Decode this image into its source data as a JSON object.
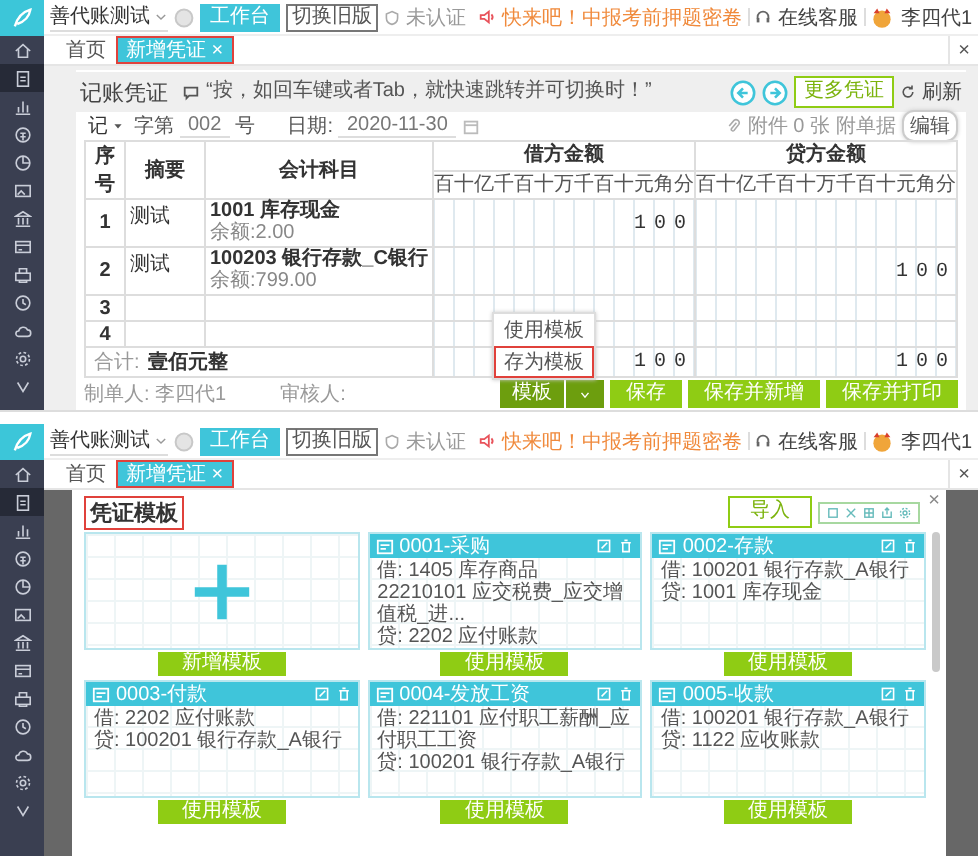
{
  "screens": [
    {
      "kind": "voucher",
      "header": {
        "company": "善代账测试",
        "workbench_button": "工作台",
        "old_version_button": "切换旧版",
        "certification": "未认证",
        "promo": "快来吧！中报考前押题密卷",
        "support": "在线客服",
        "user": "李四代1"
      },
      "tabs": [
        {
          "label": "首页",
          "selected": false,
          "highlighted": false
        },
        {
          "label": "新增凭证 ×",
          "selected": true,
          "highlighted": true
        }
      ],
      "tab_bar_close": "×",
      "sidebar_items": [
        {
          "selected": false
        },
        {
          "selected": true
        },
        {
          "selected": false
        },
        {
          "selected": false
        },
        {
          "selected": false
        },
        {
          "selected": false
        },
        {
          "selected": false
        },
        {
          "selected": false
        },
        {
          "selected": false
        },
        {
          "selected": false
        },
        {
          "selected": false
        },
        {
          "selected": false
        },
        {
          "selected": false
        }
      ],
      "voucher": {
        "title": "记账凭证",
        "notice": "“按，如回车键或者Tab，就快速跳转并可切换时！”",
        "more_button": "更多凭证",
        "refresh": "刷新",
        "voucher_word": "记",
        "word_label": "字第",
        "number": "002",
        "number_suffix": "号",
        "date_label": "日期:",
        "date": "2020-11-30",
        "attachment": "附件 0 张",
        "attach_docs": "附单据",
        "tooltip": "编辑",
        "columns": [
          "序号",
          "摘要",
          "会计科目",
          "借方金额",
          "贷方金额"
        ],
        "digit_headers": [
          "百十亿千百十万千百十元角分",
          "百十亿千百十万千百十元角分"
        ],
        "rows": [
          {
            "index": "1",
            "summary": "测试",
            "account": "1001 库存现金",
            "balance": "余额:2.00",
            "debit": "100"
          },
          {
            "index": "2",
            "summary": "测试",
            "account": "100203 银行存款_C银行",
            "balance": "余额:799.00",
            "credit": "100"
          },
          {
            "index": "3"
          },
          {
            "index": "4"
          }
        ],
        "total": {
          "label": "合计:",
          "amount_words": "壹佰元整",
          "debit": "100",
          "credit": "100"
        },
        "preparer": "制单人: 李四代1",
        "reviewer": "审核人:",
        "template_menu": [
          {
            "label": "使用模板",
            "highlighted": false
          },
          {
            "label": "存为模板",
            "highlighted": true
          }
        ],
        "buttons": [
          {
            "label": "模板",
            "kind": "split"
          },
          {
            "label": "保存",
            "kind": "plain"
          },
          {
            "label": "保存并新增",
            "kind": "plain"
          },
          {
            "label": "保存并打印",
            "kind": "plain"
          }
        ]
      }
    },
    {
      "kind": "templates",
      "header": {
        "company": "善代账测试",
        "workbench_button": "工作台",
        "old_version_button": "切换旧版",
        "certification": "未认证",
        "promo": "快来吧！中报考前押题密卷",
        "support": "在线客服",
        "user": "李四代1"
      },
      "tabs": [
        {
          "label": "首页",
          "selected": false,
          "highlighted": false
        },
        {
          "label": "新增凭证 ×",
          "selected": true,
          "highlighted": true
        }
      ],
      "tab_bar_close": "×",
      "sidebar_items": [
        {
          "selected": false
        },
        {
          "selected": true
        },
        {
          "selected": false
        },
        {
          "selected": false
        },
        {
          "selected": false
        },
        {
          "selected": false
        },
        {
          "selected": false
        },
        {
          "selected": false
        },
        {
          "selected": false
        },
        {
          "selected": false
        },
        {
          "selected": false
        },
        {
          "selected": false
        },
        {
          "selected": false
        }
      ],
      "modal": {
        "close": "×",
        "title": "凭证模板",
        "title_highlighted": true,
        "import_button": "导入",
        "cards": [
          {
            "kind": "add",
            "button": "新增模板"
          },
          {
            "kind": "template",
            "name": "0001-采购",
            "lines": [
              "借: 1405 库存商品",
              "22210101 应交税费_应交增值税_进...",
              "贷: 2202 应付账款"
            ],
            "button": "使用模板"
          },
          {
            "kind": "template",
            "name": "0002-存款",
            "lines": [
              "借: 100201 银行存款_A银行",
              "贷: 1001 库存现金"
            ],
            "button": "使用模板"
          },
          {
            "kind": "template",
            "name": "0003-付款",
            "lines": [
              "借: 2202 应付账款",
              "贷: 100201 银行存款_A银行"
            ],
            "button": "使用模板"
          },
          {
            "kind": "template",
            "name": "0004-发放工资",
            "lines": [
              "借: 221101 应付职工薪酬_应付职工工资",
              "贷: 100201 银行存款_A银行"
            ],
            "button": "使用模板"
          },
          {
            "kind": "template",
            "name": "0005-收款",
            "lines": [
              "借: 100201 银行存款_A银行",
              "贷: 1122 应收账款"
            ],
            "button": "使用模板"
          }
        ]
      }
    }
  ]
}
